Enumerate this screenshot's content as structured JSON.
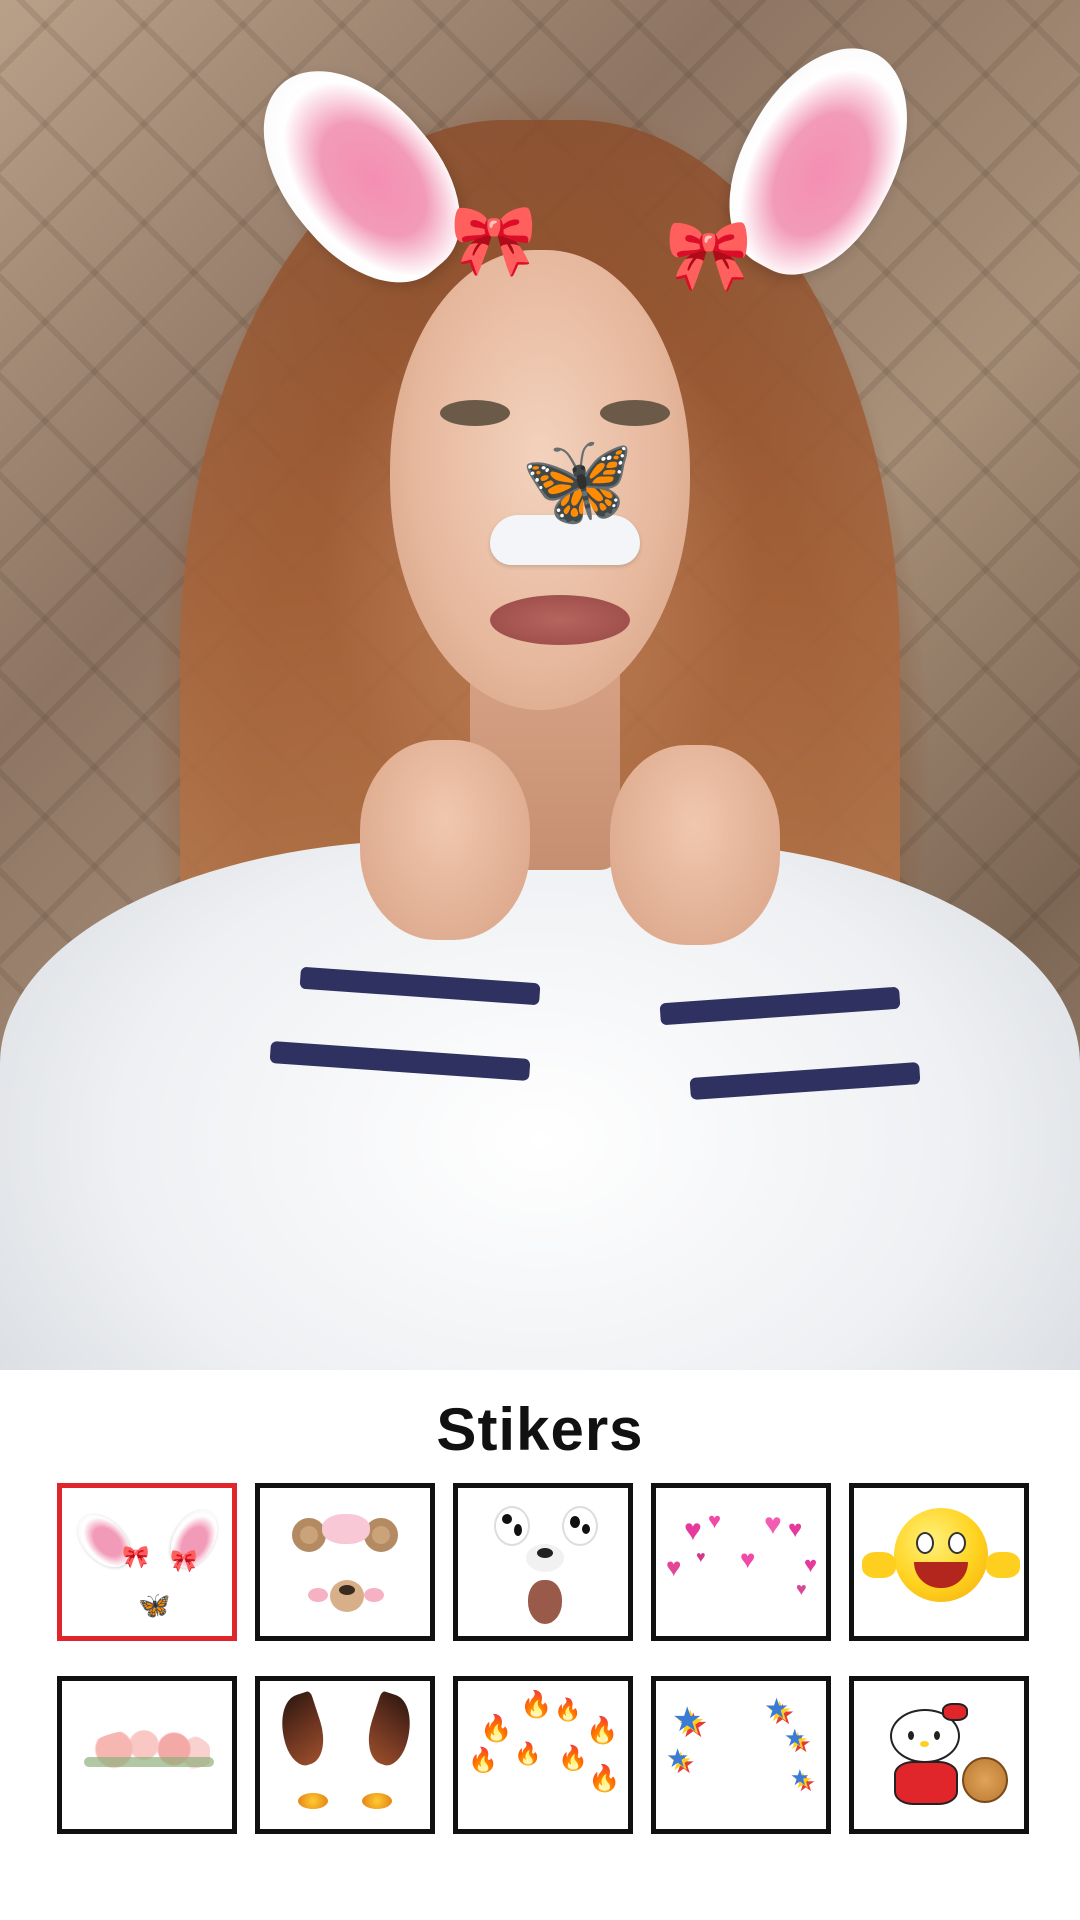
{
  "section_title": "Stikers",
  "stickers": [
    {
      "name": "bunny-ears",
      "selected": true
    },
    {
      "name": "bear-bow",
      "selected": false
    },
    {
      "name": "dalmatian-dog",
      "selected": false
    },
    {
      "name": "broken-hearts",
      "selected": false
    },
    {
      "name": "smiley-emoji",
      "selected": false
    },
    {
      "name": "flower-crown",
      "selected": false
    },
    {
      "name": "devil-horns",
      "selected": false
    },
    {
      "name": "fire-flames",
      "selected": false
    },
    {
      "name": "rainbow-stars",
      "selected": false
    },
    {
      "name": "hello-kitty",
      "selected": false
    }
  ],
  "colors": {
    "selected_border": "#e0252b",
    "tile_border": "#111111",
    "title_text": "#111111"
  }
}
